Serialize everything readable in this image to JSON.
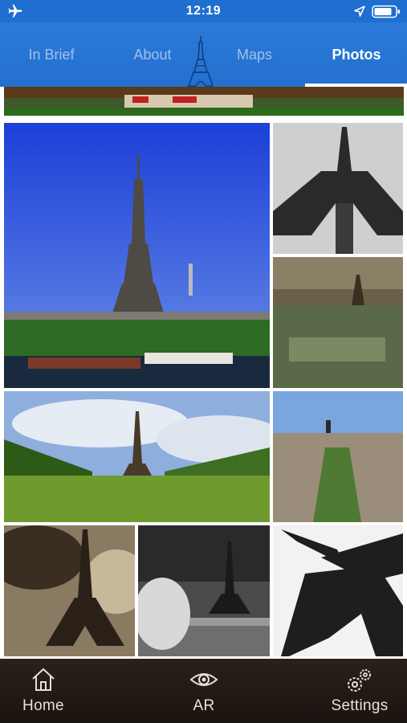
{
  "status_bar": {
    "time": "12:19"
  },
  "tabs": [
    {
      "label": "In Brief",
      "active": false
    },
    {
      "label": "About",
      "active": false
    },
    {
      "label": "Maps",
      "active": false
    },
    {
      "label": "Photos",
      "active": true
    }
  ],
  "gallery": {
    "photos": [
      {
        "subject": "Eiffel Tower panorama strip"
      },
      {
        "subject": "Eiffel Tower over the Seine, blue sky"
      },
      {
        "subject": "Eiffel Tower black and white from below"
      },
      {
        "subject": "Vintage illustrated aerial view of Paris"
      },
      {
        "subject": "Champ de Mars lawn with Eiffel Tower"
      },
      {
        "subject": "Aerial view of Paris and Champ de Mars"
      },
      {
        "subject": "Sepia Eiffel Tower with dramatic clouds"
      },
      {
        "subject": "Black and white Eiffel Tower with bridge"
      },
      {
        "subject": "Black and white Eiffel Tower detail"
      }
    ]
  },
  "bottom_nav": [
    {
      "label": "Home",
      "icon": "home-icon"
    },
    {
      "label": "AR",
      "icon": "eye-icon"
    },
    {
      "label": "Settings",
      "icon": "gears-icon"
    }
  ],
  "colors": {
    "header_blue": "#2470cf",
    "status_blue": "#1e6fd0",
    "nav_dark": "#1a1410"
  }
}
